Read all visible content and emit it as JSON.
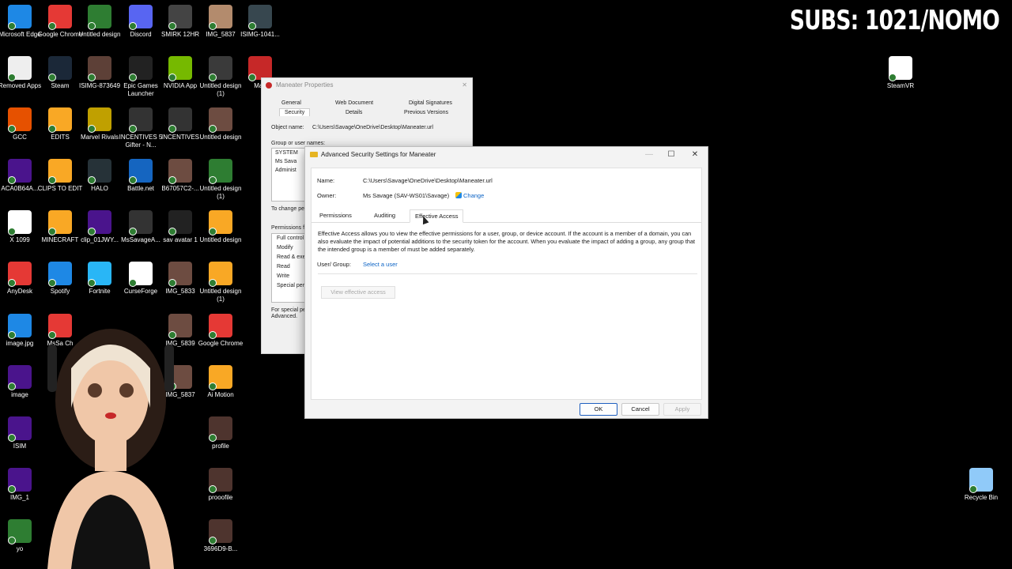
{
  "overlay": {
    "subs_text": "SUBS: 1021/NOMO"
  },
  "desktop": {
    "icons": [
      {
        "label": "Microsoft Edge",
        "color": "#1e88e5"
      },
      {
        "label": "Google Chrome",
        "color": "#e53935"
      },
      {
        "label": "Untitled design",
        "color": "#2e7d32"
      },
      {
        "label": "Discord",
        "color": "#5865f2"
      },
      {
        "label": "SMIRK 12HR",
        "color": "#444"
      },
      {
        "label": "IMG_5837",
        "color": "#b38b6d"
      },
      {
        "label": "ISIMG-1041...",
        "color": "#37474f"
      },
      {
        "label": "Removed Apps",
        "color": "#eeeeee"
      },
      {
        "label": "Steam",
        "color": "#1b2838"
      },
      {
        "label": "ISIMG-873649",
        "color": "#5d4037"
      },
      {
        "label": "Epic Games Launcher",
        "color": "#222222"
      },
      {
        "label": "NVIDIA App",
        "color": "#76b900"
      },
      {
        "label": "Untitled design (1)",
        "color": "#3a3a3a"
      },
      {
        "label": "Man",
        "color": "#c62828"
      },
      {
        "label": "GCC",
        "color": "#e65100"
      },
      {
        "label": "EDITS",
        "color": "#f9a825"
      },
      {
        "label": "Marvel Rivals",
        "color": "#c0a000"
      },
      {
        "label": "INCENTIVES 5 Gifter - N...",
        "color": "#333333"
      },
      {
        "label": "INCENTIVES",
        "color": "#333333"
      },
      {
        "label": "Untitled design",
        "color": "#6d4c41"
      },
      {
        "label": "ACA0B64A...",
        "color": "#4a148c"
      },
      {
        "label": "CLIPS TO EDIT",
        "color": "#f9a825"
      },
      {
        "label": "HALO",
        "color": "#263238"
      },
      {
        "label": "Battle.net",
        "color": "#1565c0"
      },
      {
        "label": "B67057C2-...",
        "color": "#6d4c41"
      },
      {
        "label": "Untitled design (1)",
        "color": "#2e7d32"
      },
      {
        "label": "X 1099",
        "color": "#ffffff"
      },
      {
        "label": "MINECRAFT",
        "color": "#f9a825"
      },
      {
        "label": "clip_01JWY...",
        "color": "#4a148c"
      },
      {
        "label": "MsSavageA...",
        "color": "#333333"
      },
      {
        "label": "sav avatar 1",
        "color": "#222222"
      },
      {
        "label": "Untitled design",
        "color": "#f9a825"
      },
      {
        "label": "AnyDesk",
        "color": "#e53935"
      },
      {
        "label": "Spotify",
        "color": "#1e88e5"
      },
      {
        "label": "Fortnite",
        "color": "#29b6f6"
      },
      {
        "label": "CurseForge",
        "color": "#ffffff"
      },
      {
        "label": "IMG_5833",
        "color": "#6d4c41"
      },
      {
        "label": "Untitled design (1)",
        "color": "#f9a825"
      },
      {
        "label": "image.jpg",
        "color": "#1e88e5"
      },
      {
        "label": "MsSa Ch",
        "color": "#e53935"
      },
      {
        "label": "IMG_5839",
        "color": "#6d4c41"
      },
      {
        "label": "Google Chrome",
        "color": "#e53935"
      },
      {
        "label": "image",
        "color": "#4a148c"
      },
      {
        "label": "IMG_5837",
        "color": "#6d4c41"
      },
      {
        "label": "Ai Motion",
        "color": "#f9a825"
      },
      {
        "label": "ISIM",
        "color": "#4a148c"
      },
      {
        "label": "profile",
        "color": "#4e342e"
      },
      {
        "label": "IMG_1",
        "color": "#4a148c"
      },
      {
        "label": "prooofile",
        "color": "#4e342e"
      },
      {
        "label": "yo",
        "color": "#2e7d32"
      },
      {
        "label": "3696D9-B...",
        "color": "#4e342e"
      },
      {
        "label": "SteamVR",
        "color": "#ffffff"
      },
      {
        "label": "Recycle Bin",
        "color": "#90caf9"
      }
    ]
  },
  "props_window": {
    "title": "Maneater Properties",
    "tabs_row1": [
      "General",
      "Web Document",
      "Digital Signatures"
    ],
    "tabs_row2": [
      "Security",
      "Details",
      "Previous Versions"
    ],
    "object_name_label": "Object name:",
    "object_name_value": "C:\\Users\\Savage\\OneDrive\\Desktop\\Maneater.url",
    "group_label": "Group or user names:",
    "groups": [
      "SYSTEM",
      "Ms Sava",
      "Administ"
    ],
    "to_change": "To change pe",
    "permissions_label": "Permissions fo",
    "permissions": [
      "Full control",
      "Modify",
      "Read & exe",
      "Read",
      "Write",
      "Special per"
    ],
    "special_note_1": "For special pe",
    "special_note_2": "Advanced."
  },
  "dialog": {
    "title": "Advanced Security Settings for Maneater",
    "name_label": "Name:",
    "name_value": "C:\\Users\\Savage\\OneDrive\\Desktop\\Maneater.url",
    "owner_label": "Owner:",
    "owner_value": "Ms Savage (SAV-WS01\\Savage)",
    "change_link": "Change",
    "tabs": [
      "Permissions",
      "Auditing",
      "Effective Access"
    ],
    "description": "Effective Access allows you to view the effective permissions for a user, group, or device account. If the account is a member of a domain, you can also evaluate the impact of potential additions to the security token for the account. When you evaluate the impact of adding a group, any group that the intended group is a member of must be added separately.",
    "user_group_label": "User/ Group:",
    "select_user_link": "Select a user",
    "view_effective_access": "View effective access",
    "ok": "OK",
    "cancel": "Cancel",
    "apply": "Apply",
    "minimize_icon": "minimize-icon",
    "maximize_icon": "maximize-icon",
    "close_icon": "close-icon"
  }
}
